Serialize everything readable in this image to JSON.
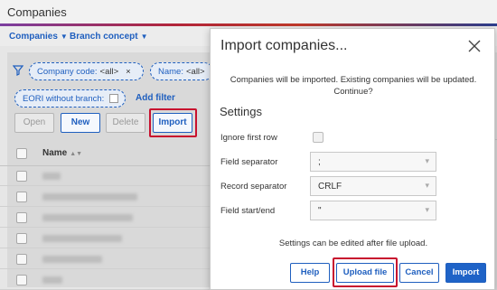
{
  "app": {
    "title": "Companies"
  },
  "nav": {
    "companies": "Companies",
    "branch_concept": "Branch concept"
  },
  "filters": {
    "company_code": {
      "label": "Company code:",
      "value": "<all>"
    },
    "name": {
      "label": "Name:",
      "value": "<all>"
    },
    "eori": {
      "label": "EORI without branch:"
    },
    "add_filter": "Add filter",
    "remove_glyph": "×"
  },
  "toolbar": {
    "open": "Open",
    "new": "New",
    "delete": "Delete",
    "import": "Import"
  },
  "table": {
    "name_header": "Name",
    "row_count": 7
  },
  "dialog": {
    "title": "Import companies...",
    "message_line1": "Companies will be imported. Existing companies will be updated.",
    "message_line2": "Continue?",
    "settings_heading": "Settings",
    "fields": {
      "ignore_first_row": {
        "label": "Ignore first row",
        "checked": false
      },
      "field_separator": {
        "label": "Field separator",
        "value": ";"
      },
      "record_separator": {
        "label": "Record separator",
        "value": "CRLF"
      },
      "field_start_end": {
        "label": "Field start/end",
        "value": "\""
      }
    },
    "note": "Settings can be edited after file upload.",
    "buttons": {
      "help": "Help",
      "upload": "Upload file",
      "cancel": "Cancel",
      "import": "Import"
    }
  },
  "colors": {
    "accent_blue": "#1f63c7",
    "highlight_red": "#c8102e"
  }
}
